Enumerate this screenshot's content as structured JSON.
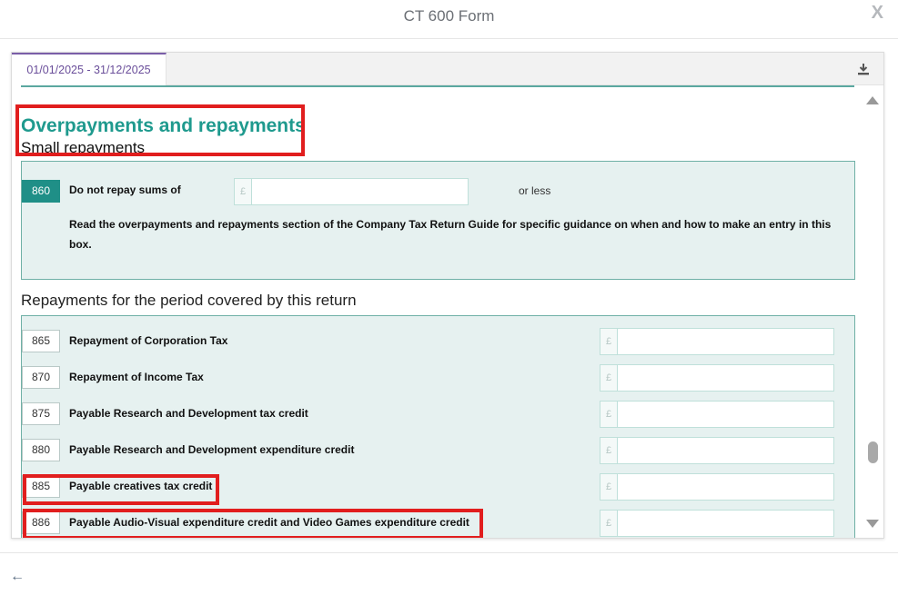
{
  "modal": {
    "title": "CT 600 Form",
    "close_label": "X"
  },
  "tab": {
    "label": "01/01/2025 - 31/12/2025"
  },
  "section": {
    "title": "Overpayments and repayments",
    "subtitle": "Small repayments"
  },
  "small_repayments": {
    "number": "860",
    "label": "Do not repay sums of",
    "currency": "£",
    "value": "",
    "suffix": "or less",
    "guidance": "Read the overpayments and repayments section of the Company Tax Return Guide for specific guidance on when and how to make an entry in this box."
  },
  "repayments": {
    "title": "Repayments for the period covered by this return",
    "rows": [
      {
        "number": "865",
        "label": "Repayment of Corporation Tax",
        "currency": "£",
        "value": ""
      },
      {
        "number": "870",
        "label": "Repayment of Income Tax",
        "currency": "£",
        "value": ""
      },
      {
        "number": "875",
        "label": "Payable Research and Development tax credit",
        "currency": "£",
        "value": ""
      },
      {
        "number": "880",
        "label": "Payable Research and Development expenditure credit",
        "currency": "£",
        "value": ""
      },
      {
        "number": "885",
        "label": "Payable creatives tax credit",
        "currency": "£",
        "value": ""
      },
      {
        "number": "886",
        "label": "Payable Audio-Visual expenditure credit and Video Games expenditure credit",
        "currency": "£",
        "value": ""
      }
    ]
  },
  "colors": {
    "teal": "#1f9a8e",
    "tab_accent": "#7a5ea8",
    "highlight": "#e11e1e",
    "box_bg": "#e6f1f0"
  },
  "icons": [
    "download-icon",
    "scroll-up-icon",
    "scroll-down-icon",
    "back-arrow-icon"
  ]
}
